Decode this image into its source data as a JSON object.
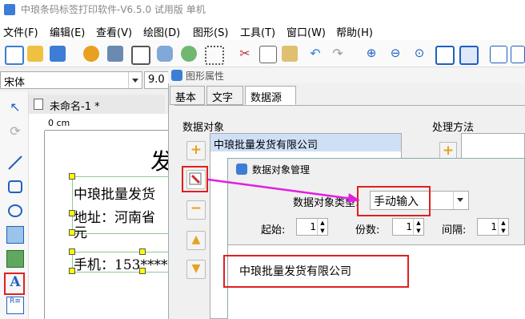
{
  "window": {
    "title": "中琅条码标签打印软件-V6.5.0 试用版 单机"
  },
  "menu": [
    "文件(F)",
    "编辑(E)",
    "查看(V)",
    "绘图(D)",
    "图形(S)",
    "工具(T)",
    "窗口(W)",
    "帮助(H)"
  ],
  "fontbar": {
    "font_name": "宋体",
    "font_size": "9.0"
  },
  "document": {
    "tab_label": "未命名-1 *",
    "ruler_zero": "0 cm",
    "text_title_char": "发",
    "line1": "中琅批量发货",
    "line2": "地址：河南省",
    "line2_wrap": "元",
    "line3": "手机：153****"
  },
  "properties": {
    "title": "图形属性",
    "tabs": [
      "基本",
      "文字",
      "数据源"
    ],
    "active_tab": "数据源",
    "data_object_label": "数据对象",
    "data_object_item": "中琅批量发货有限公司",
    "method_label": "处理方法"
  },
  "dialog": {
    "title": "数据对象管理",
    "type_label": "数据对象类型:",
    "type_value": "手动输入",
    "start_label": "起始:",
    "start_value": "1",
    "copies_label": "份数:",
    "copies_value": "1",
    "interval_label": "间隔:",
    "interval_value": "1",
    "content": "中琅批量发货有限公司"
  },
  "colors": {
    "highlight_red": "#e02020",
    "arrow_magenta": "#e020e0",
    "accent_blue": "#3c7dd6"
  }
}
